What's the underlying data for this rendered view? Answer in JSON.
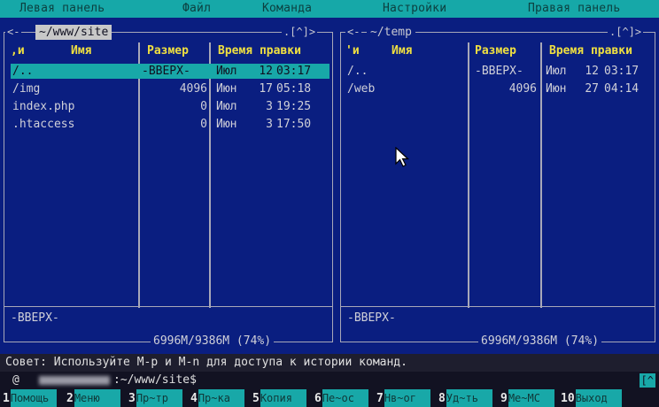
{
  "menu": [
    "Левая панель",
    "Файл",
    "Команда",
    "Настройки",
    "Правая панель"
  ],
  "left_panel": {
    "path": "~/www/site",
    "nav_left": "<-",
    "nav_right": ".[^]>",
    "columns": [
      ",и",
      "Имя",
      "Размер",
      "Время правки"
    ],
    "rows": [
      {
        "name": "/..",
        "size": "-ВВЕРХ-",
        "month": "Июл",
        "day": "12",
        "time": "03:17"
      },
      {
        "name": "/img",
        "size": "4096",
        "month": "Июн",
        "day": "17",
        "time": "05:18"
      },
      {
        "name": " index.php",
        "size": "0",
        "month": "Июл",
        "day": "3",
        "time": "19:25"
      },
      {
        "name": " .htaccess",
        "size": "0",
        "month": "Июн",
        "day": "3",
        "time": "17:50"
      }
    ],
    "mini_status": "-ВВЕРХ-",
    "disk": "6996M/9386M (74%)"
  },
  "right_panel": {
    "path": "~/temp",
    "nav_left": "<-",
    "nav_right": ".[^]>",
    "columns": [
      "'и",
      "Имя",
      "Размер",
      "Время правки"
    ],
    "rows": [
      {
        "name": "/..",
        "size": "-ВВЕРХ-",
        "month": "Июл",
        "day": "12",
        "time": "03:17"
      },
      {
        "name": "/web",
        "size": "4096",
        "month": "Июн",
        "day": "27",
        "time": "04:14"
      }
    ],
    "mini_status": "-ВВЕРХ-",
    "disk": "6996M/9386M (74%)"
  },
  "hint": "Совет: Используйте M-p и M-n для доступа к истории команд.",
  "prompt": {
    "user": "@",
    "path": ":~/www/site$",
    "right": "[^"
  },
  "fkeys": [
    {
      "num": "1",
      "label": "Помощь"
    },
    {
      "num": "2",
      "label": "Меню"
    },
    {
      "num": "3",
      "label": "Пр~тр"
    },
    {
      "num": "4",
      "label": "Пр~ка"
    },
    {
      "num": "5",
      "label": "Копия"
    },
    {
      "num": "6",
      "label": "Пе~ос"
    },
    {
      "num": "7",
      "label": "Нв~ог"
    },
    {
      "num": "8",
      "label": "Уд~ть"
    },
    {
      "num": "9",
      "label": "Ме~МС"
    },
    {
      "num": "10",
      "label": "Выход"
    }
  ],
  "colors": {
    "panel_bg": "#0a1e80",
    "selection": "#18a8a8",
    "header": "#f0e040",
    "menubar": "#16a8a8"
  }
}
